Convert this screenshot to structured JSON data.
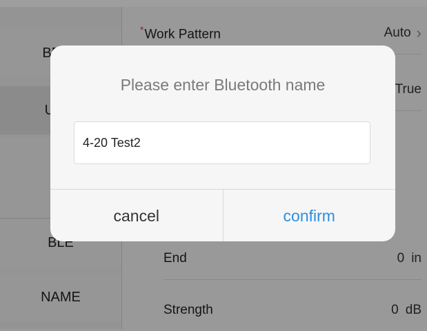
{
  "sidebar": {
    "items": [
      {
        "label": "BEEP"
      },
      {
        "label": "UNIT"
      },
      {
        "label": ""
      },
      {
        "label": ""
      },
      {
        "label": "BLE"
      },
      {
        "label": "NAME"
      }
    ]
  },
  "settings": {
    "rows": [
      {
        "label": "Work Pattern",
        "value": "Auto",
        "required": true
      },
      {
        "label": "",
        "value": "True"
      },
      {
        "label": "End",
        "value": "0",
        "unit": "in"
      },
      {
        "label": "Strength",
        "value": "0",
        "unit": "dB"
      }
    ],
    "required_marker": "*"
  },
  "dialog": {
    "title": "Please enter Bluetooth name",
    "input_value": "4-20 Test2",
    "cancel_label": "cancel",
    "confirm_label": "confirm"
  },
  "colors": {
    "accent": "#2d8ee0",
    "required": "#e03a3a"
  },
  "icons": {
    "chevron": "chevron-right-icon"
  }
}
